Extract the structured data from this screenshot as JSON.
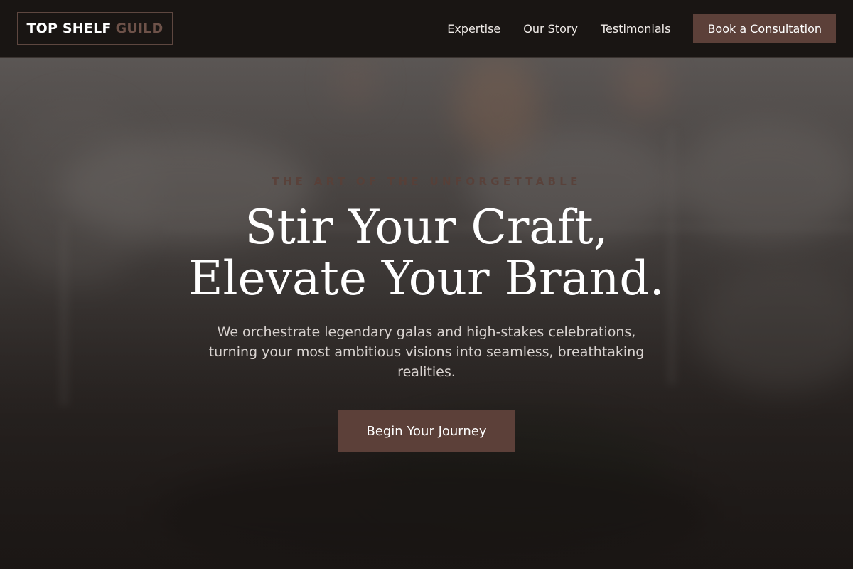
{
  "header": {
    "logo": {
      "word1": "TOP SHELF",
      "word2": "GUILD"
    },
    "nav": [
      {
        "label": "Expertise"
      },
      {
        "label": "Our Story"
      },
      {
        "label": "Testimonials"
      }
    ],
    "cta_label": "Book a Consultation"
  },
  "hero": {
    "eyebrow": "THE ART OF THE UNFORGETTABLE",
    "headline_line1": "Stir Your Craft,",
    "headline_line2": "Elevate Your Brand.",
    "subtitle": "We orchestrate legendary galas and high-stakes celebrations, turning your most ambitious visions into seamless, breathtaking realities.",
    "cta_label": "Begin Your Journey"
  },
  "colors": {
    "accent": "#5c4039",
    "logo_accent": "#6e5249",
    "header_bg": "#191513"
  }
}
